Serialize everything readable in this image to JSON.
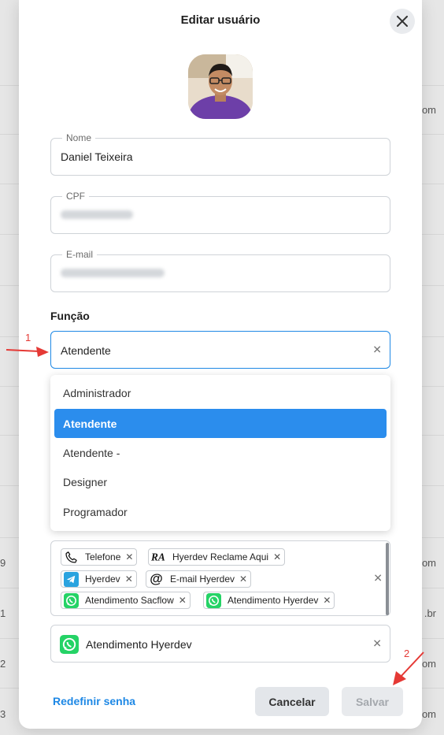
{
  "background": {
    "left_numbers": [
      "9",
      "1",
      "2",
      "3"
    ],
    "right_fragments": [
      "om",
      "om",
      ".br",
      "om",
      "om"
    ]
  },
  "modal": {
    "title": "Editar usuário",
    "fields": {
      "name": {
        "label": "Nome",
        "value": "Daniel Teixeira"
      },
      "cpf": {
        "label": "CPF",
        "value": ""
      },
      "email": {
        "label": "E-mail",
        "value": ""
      }
    },
    "role": {
      "section_label": "Função",
      "selected": "Atendente",
      "options": [
        "Administrador",
        "Atendente",
        "Atendente -",
        "Designer",
        "Programador"
      ],
      "selected_index": 1
    },
    "channels": {
      "chips": [
        {
          "label": "Telefone",
          "icon": "phone-icon"
        },
        {
          "label": "Hyerdev Reclame Aqui",
          "icon": "reclame-aqui-icon"
        },
        {
          "label": "Hyerdev",
          "icon": "telegram-icon"
        },
        {
          "label": "E-mail Hyerdev",
          "icon": "at-sign-icon"
        },
        {
          "label": "Atendimento Sacflow",
          "icon": "whatsapp-icon"
        },
        {
          "label": "Atendimento Hyerdev",
          "icon": "whatsapp-icon"
        }
      ]
    },
    "default_channel": {
      "label": "Atendimento Hyerdev",
      "icon": "whatsapp-icon"
    },
    "reset_password_label": "Redefinir senha",
    "cancel_label": "Cancelar",
    "save_label": "Salvar"
  },
  "annotations": [
    "1",
    "2"
  ],
  "colors": {
    "accent": "#1e88e5",
    "selected_option": "#2b8ded",
    "annotation": "#e53935",
    "whatsapp": "#25d366",
    "telegram": "#2aa3df"
  }
}
